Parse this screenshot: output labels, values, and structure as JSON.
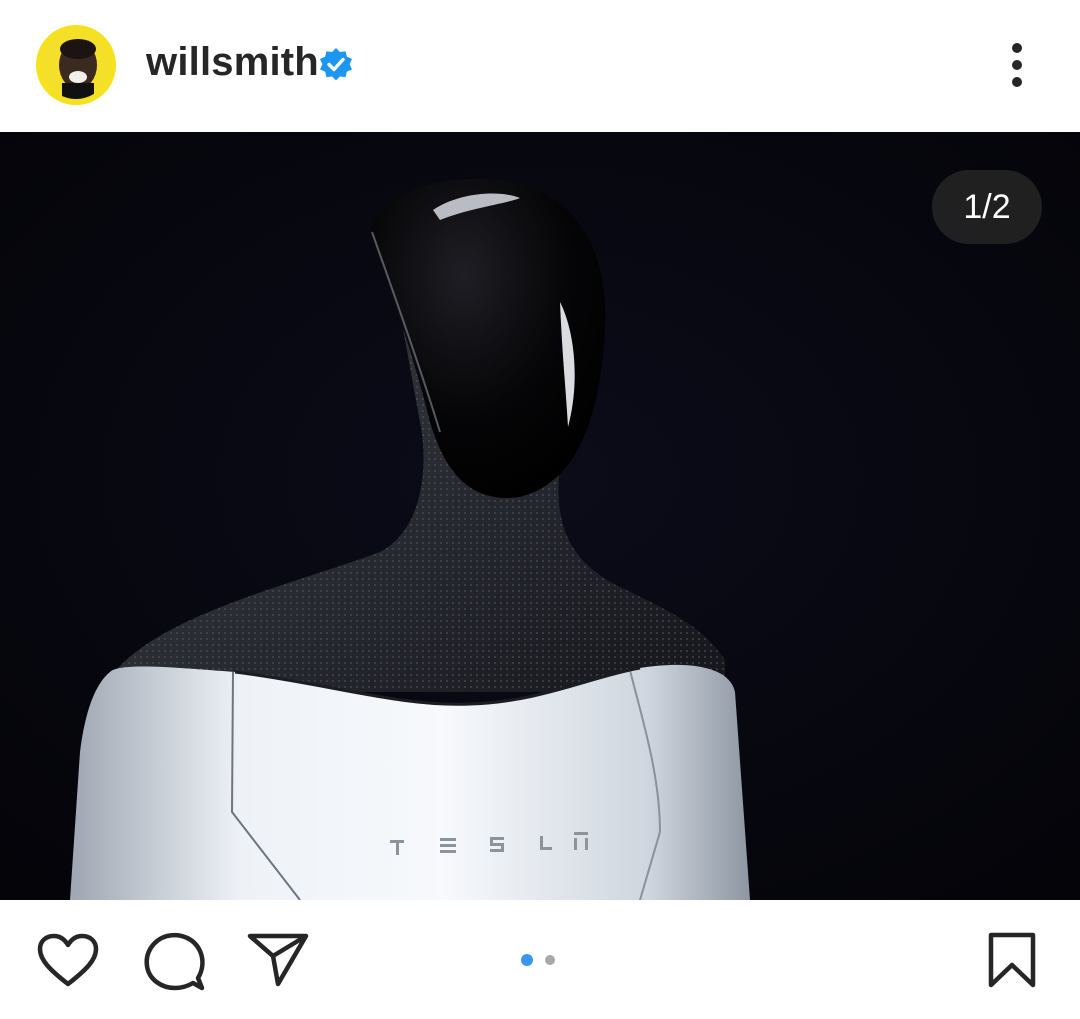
{
  "header": {
    "username": "willsmith",
    "verified": true,
    "avatar_icon": "profile-avatar",
    "more_icon": "more-vertical-icon"
  },
  "post": {
    "image_description_icon": "post-photo",
    "brand_text": "TESLA",
    "counter": "1/2"
  },
  "actions": {
    "like_icon": "heart-icon",
    "comment_icon": "comment-icon",
    "share_icon": "send-icon",
    "save_icon": "bookmark-icon",
    "carousel": {
      "total": 2,
      "active_index": 0
    }
  },
  "colors": {
    "accent_blue": "#3897f0",
    "verified_blue": "#1c96f0",
    "text_dark": "#262626",
    "dot_inactive": "#a8a8a8",
    "avatar_ring": "#f5e11e"
  }
}
